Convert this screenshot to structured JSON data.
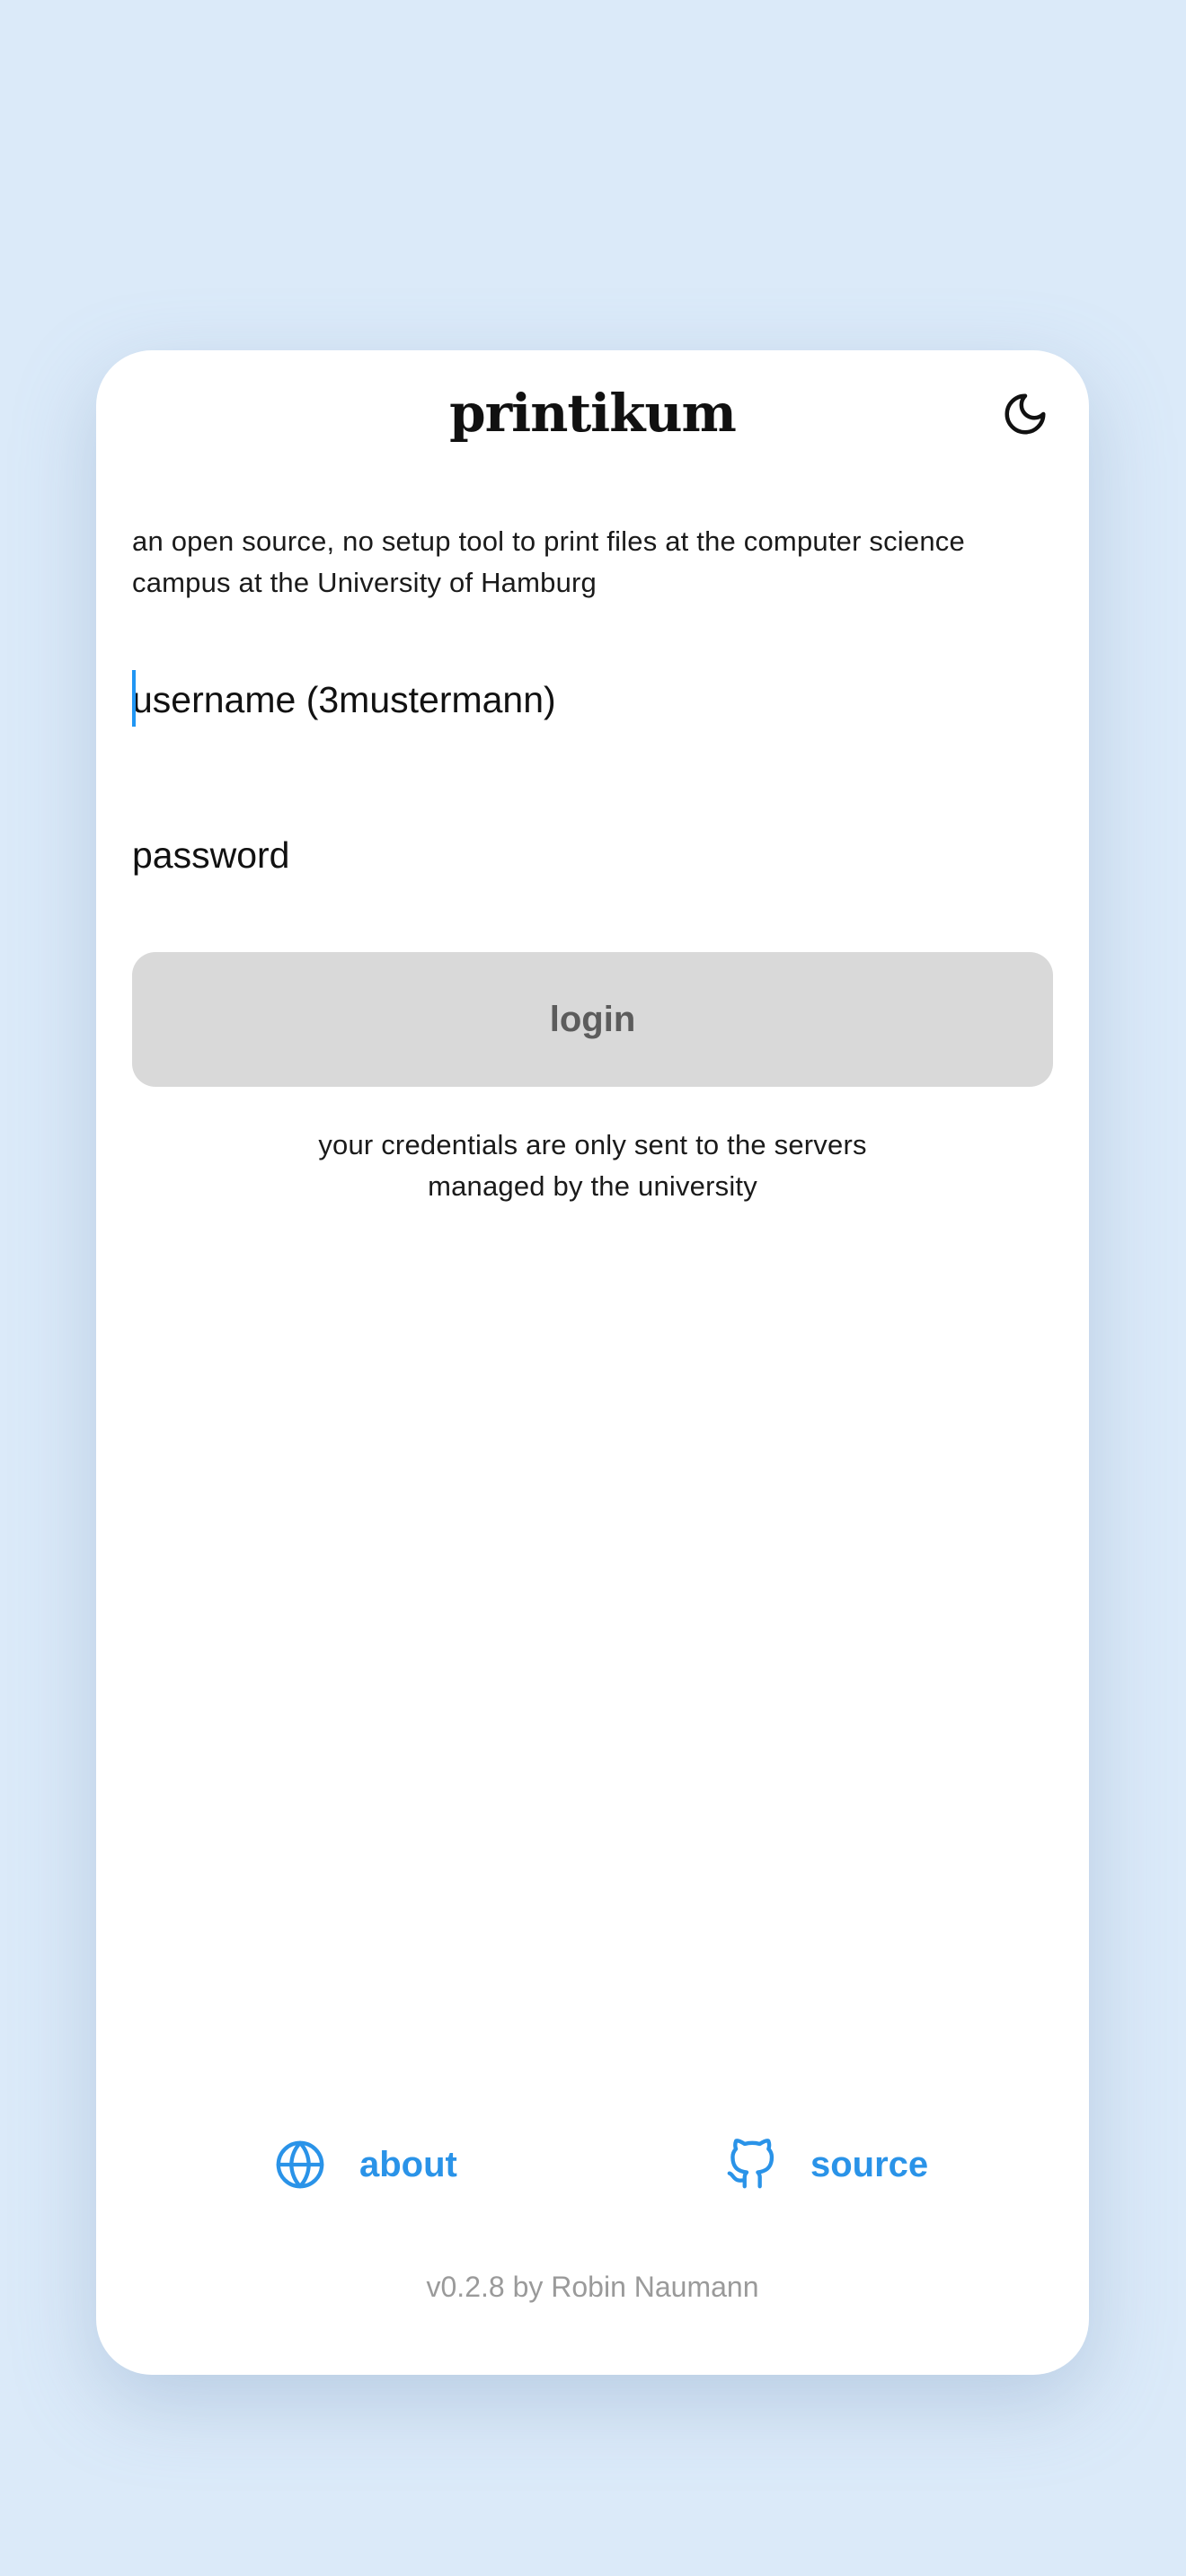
{
  "app": {
    "title": "printikum",
    "description": "an open source, no setup tool to print files at the computer science campus at the University of Hamburg"
  },
  "theme_toggle": {
    "icon": "moon-icon"
  },
  "form": {
    "username_placeholder": "username (3mustermann)",
    "password_placeholder": "password",
    "login_label": "login",
    "note_line1": "your credentials are only sent to the servers",
    "note_line2": "managed by the university"
  },
  "footer": {
    "about": {
      "label": "about",
      "icon": "globe-icon"
    },
    "source": {
      "label": "source",
      "icon": "github-icon"
    },
    "version": "v0.2.8 by Robin Naumann"
  },
  "colors": {
    "page_background": "#dbeaf9",
    "card_background": "#ffffff",
    "accent": "#2a93e8",
    "button_disabled_background": "#d9d9d9",
    "button_disabled_text": "#5c5c5c",
    "muted_text": "#9a9a9a",
    "caret": "#2196f3"
  }
}
